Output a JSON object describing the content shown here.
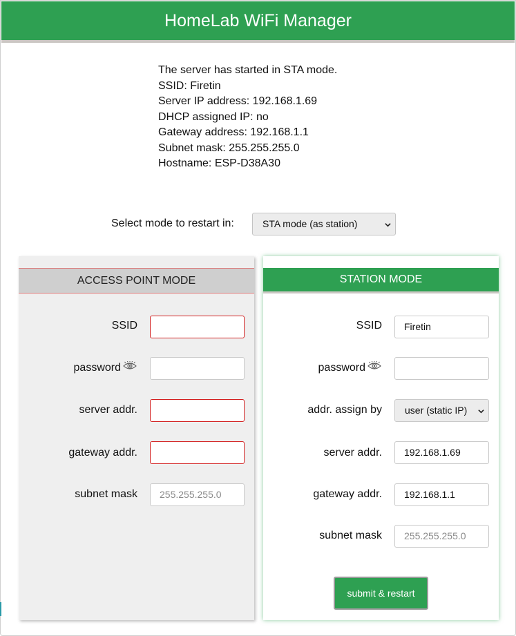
{
  "header": {
    "title": "HomeLab WiFi Manager"
  },
  "status": {
    "line1": "The server has started in STA mode.",
    "line2": "SSID: Firetin",
    "line3": "Server IP address: 192.168.1.69",
    "line4": "DHCP assigned IP: no",
    "line5": "Gateway address: 192.168.1.1",
    "line6": "Subnet mask: 255.255.255.0",
    "line7": "Hostname: ESP-D38A30"
  },
  "mode": {
    "label": "Select mode to restart in:",
    "selected": "STA mode (as station)"
  },
  "ap": {
    "title": "ACCESS POINT MODE",
    "ssid_label": "SSID",
    "ssid_value": "",
    "password_label": "password",
    "password_value": "",
    "server_label": "server addr.",
    "server_value": "",
    "gateway_label": "gateway addr.",
    "gateway_value": "",
    "subnet_label": "subnet mask",
    "subnet_placeholder": "255.255.255.0"
  },
  "sta": {
    "title": "STATION MODE",
    "ssid_label": "SSID",
    "ssid_value": "Firetin",
    "password_label": "password",
    "password_value": "",
    "assign_label": "addr. assign by",
    "assign_value": "user (static IP)",
    "server_label": "server addr.",
    "server_value": "192.168.1.69",
    "gateway_label": "gateway addr.",
    "gateway_value": "192.168.1.1",
    "subnet_label": "subnet mask",
    "subnet_placeholder": "255.255.255.0",
    "submit_label": "submit & restart"
  },
  "colors": {
    "accent": "#2ea052",
    "invalid_border": "#d32020",
    "panel_gray": "#efefef"
  },
  "icons": {
    "password_toggle": "eye-icon",
    "dropdown": "chevron-down-icon"
  }
}
